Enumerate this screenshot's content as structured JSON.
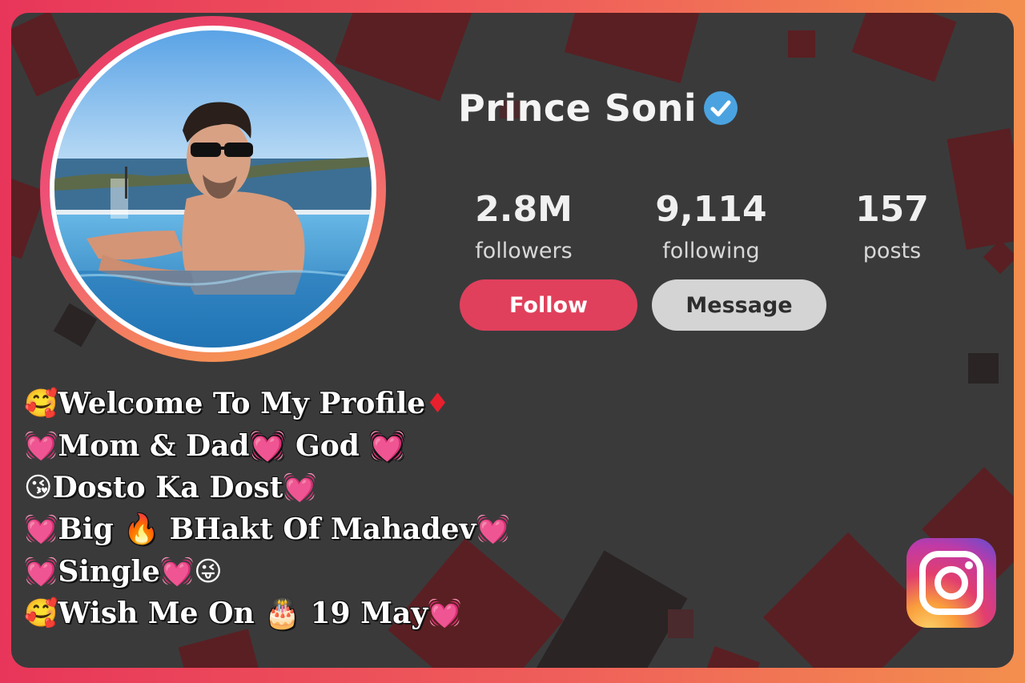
{
  "profile": {
    "name": "Prince Soni",
    "verified": true,
    "stats": [
      {
        "value": "2.8M",
        "label": "followers"
      },
      {
        "value": "9,114",
        "label": "following"
      },
      {
        "value": "157",
        "label": "posts"
      }
    ],
    "buttons": {
      "follow": "Follow",
      "message": "Message"
    }
  },
  "bio": [
    {
      "lead": "🥰",
      "text": "Welcome To My Profile",
      "trail": "♦"
    },
    {
      "lead": "💓",
      "text": "Mom & Dad",
      "trail": "💓 God 💓"
    },
    {
      "lead": "😘",
      "text": "Dosto Ka Dost",
      "trail": "💓"
    },
    {
      "lead": "💓",
      "text": "Big 🔥 BHakt Of Mahadev",
      "trail": "💓"
    },
    {
      "lead": "💓",
      "text": "Single",
      "trail": "💓😜"
    },
    {
      "lead": "🥰",
      "text": "Wish Me On 🎂 19 May",
      "trail": "💓"
    }
  ],
  "colors": {
    "frame_gradient": [
      "#e8365a",
      "#f38f4e"
    ],
    "card_bg": "#3a3a3b",
    "follow_button": "#e0405c",
    "message_button": "#d4d4d4",
    "verified_badge": "#4aa3e0"
  },
  "icons": {
    "verified": "verified-check-icon",
    "brand": "instagram-logo-icon"
  }
}
